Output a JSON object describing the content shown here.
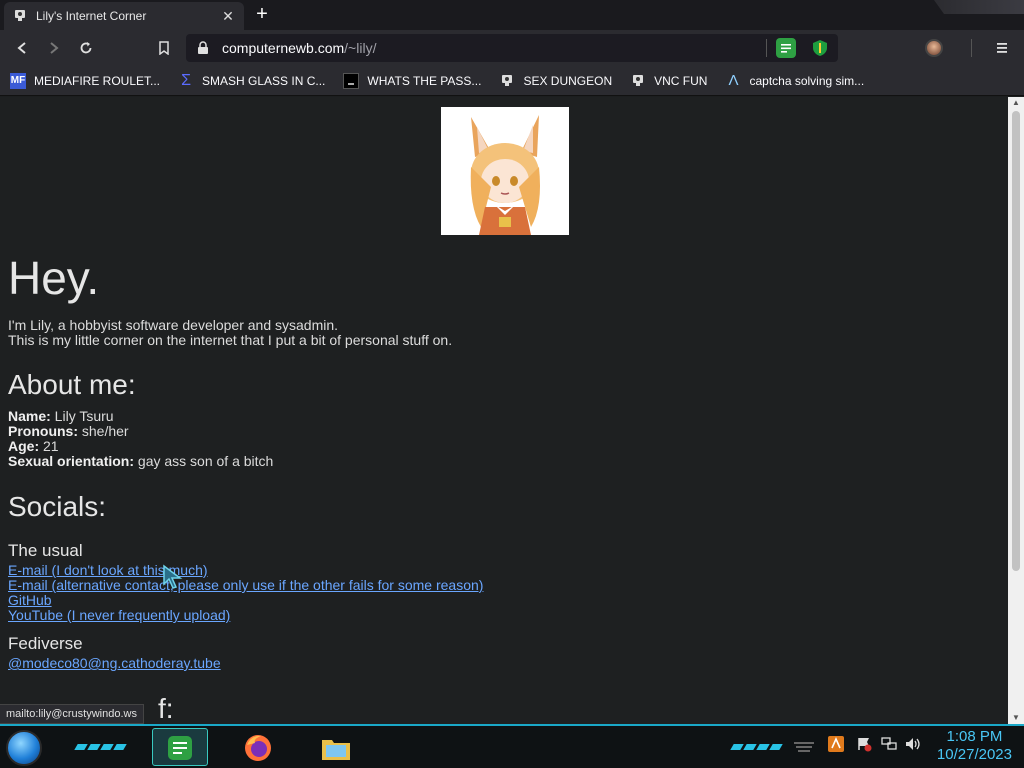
{
  "browser": {
    "tab_title": "Lily's Internet Corner",
    "url_host": "computernewb.com",
    "url_path": "/~lily/",
    "bookmarks": [
      {
        "icon": "mediafire-icon",
        "label": "MEDIAFIRE ROULET..."
      },
      {
        "icon": "sigma-icon",
        "label": "SMASH GLASS IN C..."
      },
      {
        "icon": "dark-square-icon",
        "label": "WHATS THE PASS..."
      },
      {
        "icon": "vnc-icon",
        "label": "SEX DUNGEON"
      },
      {
        "icon": "vnc-icon",
        "label": "VNC FUN"
      },
      {
        "icon": "lambda-icon",
        "label": "captcha solving sim..."
      }
    ],
    "status_url": "mailto:lily@crustywindo.ws"
  },
  "page": {
    "heading": "Hey.",
    "intro_line1": "I'm Lily, a hobbyist software developer and sysadmin.",
    "intro_line2": "This is my little corner on the internet that I put a bit of personal stuff on.",
    "about_heading": "About me:",
    "about": [
      {
        "key": "Name:",
        "value": " Lily Tsuru"
      },
      {
        "key": "Pronouns:",
        "value": " she/her"
      },
      {
        "key": "Age:",
        "value": " 21"
      },
      {
        "key": "Sexual orientation:",
        "value": " gay ass son of a bitch"
      }
    ],
    "socials_heading": "Socials:",
    "usual_heading": "The usual",
    "usual_links": [
      "E-mail (I don't look at this much)",
      "E-mail (alternative contact, please only use if the other fails for some reason)",
      "GitHub",
      "YouTube (I never frequently upload)"
    ],
    "fediverse_heading": "Fediverse",
    "fediverse_link": "@modeco80@ng.cathoderay.tube",
    "next_heading_partial": "f:"
  },
  "taskbar": {
    "time": "1:08 PM",
    "date": "10/27/2023"
  },
  "colors": {
    "link": "#6aa6ff",
    "page_bg": "#1e2021",
    "accent": "#29c3e6"
  }
}
